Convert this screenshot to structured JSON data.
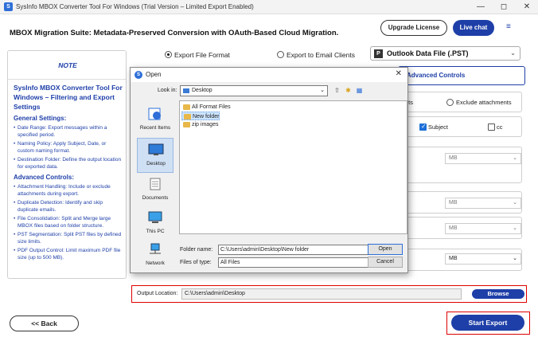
{
  "window": {
    "title": "SysInfo MBOX Converter Tool For Windows (Trial Version – Limited Export Enabled)",
    "app_icon": "S"
  },
  "header": {
    "title": "MBOX Migration Suite: Metadata-Preserved Conversion with OAuth-Based Cloud Migration.",
    "upgrade_label": "Upgrade License",
    "live_chat_label": "Live chat",
    "menu_icon": "≡"
  },
  "note": {
    "heading": "NOTE",
    "intro": "SysInfo MBOX Converter Tool For Windows – Filtering and Export Settings",
    "general_title": "General Settings:",
    "general_items": [
      "Date Range: Export messages within a specified period.",
      "Naming Policy: Apply Subject, Date, or custom naming format.",
      "Destination Folder: Define the output location for exported data."
    ],
    "advanced_title": "Advanced Controls:",
    "advanced_items": [
      "Attachment Handling: Include or exclude attachments during export.",
      "Duplicate Detection: Identify and skip duplicate emails.",
      "File Consolidation: Split and Merge large MBOX files based on folder structure.",
      "PST Segmentation: Split PST files by defined size limits.",
      "PDF Output Control: Limit maximum PDF file size (up to 500 MB)."
    ]
  },
  "export": {
    "option_file": "Export File Format",
    "option_email": "Export to Email Clients",
    "format_selected": "Outlook Data File (.PST)",
    "format_icon": "P"
  },
  "right_panel": {
    "advanced_tab": "Advanced Controls",
    "attachments_partial": "nts",
    "exclude_attachments": "Exclude attachments",
    "subject_label": "Subject",
    "cc_label": "cc",
    "unit_mb": "MB"
  },
  "dialog": {
    "title": "Open",
    "look_in_label": "Look in:",
    "look_in_value": "Desktop",
    "places": [
      "Recent Items",
      "Desktop",
      "Documents",
      "This PC",
      "Network"
    ],
    "files": [
      "All Format Files",
      "New folder",
      "zip images"
    ],
    "folder_name_label": "Folder name:",
    "folder_name_value": "C:\\Users\\admin\\Desktop\\New folder",
    "files_of_type_label": "Files of type:",
    "files_of_type_value": "All Files",
    "open_label": "Open",
    "cancel_label": "Cancel"
  },
  "output": {
    "label": "Output Location:",
    "path": "C:\\Users\\admin\\Desktop",
    "browse_label": "Browse"
  },
  "footer": {
    "back_label": "<<  Back",
    "start_export_label": "Start Export"
  }
}
